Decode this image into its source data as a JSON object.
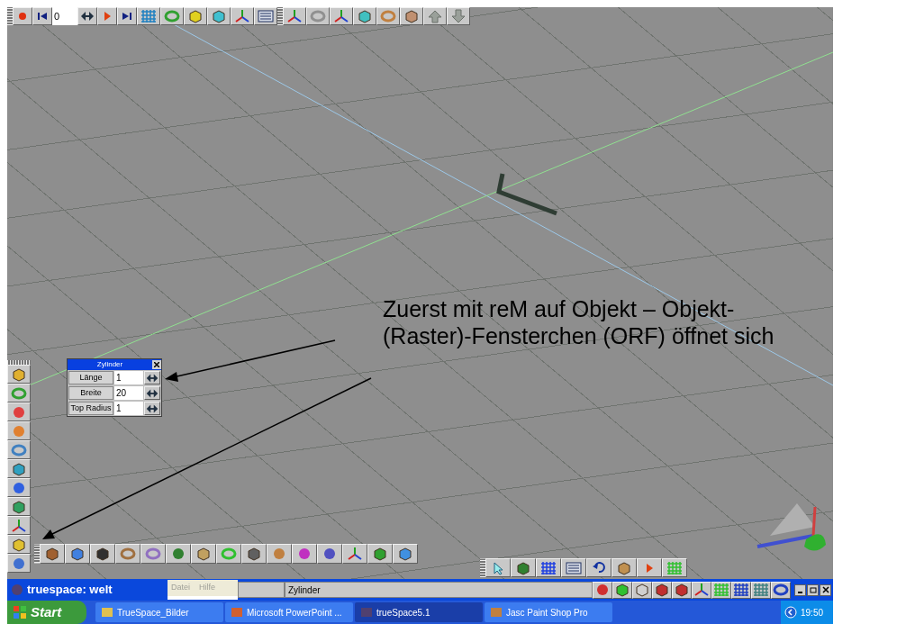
{
  "top_toolbar": {
    "frame_field": "0"
  },
  "parameter_panel": {
    "title": "Zylinder",
    "params": [
      {
        "label": "Länge",
        "value": "1"
      },
      {
        "label": "Breite",
        "value": "20"
      },
      {
        "label": "Top Radius",
        "value": "1"
      }
    ]
  },
  "annotation": "Zuerst mit reM auf Objekt – Objekt-\n(Raster)-Fensterchen (ORF) öffnet sich",
  "title_bar": {
    "title": "truespace: welt",
    "menu": [
      "Datei",
      "Hilfe"
    ],
    "status": "Zylinder"
  },
  "taskbar": {
    "start": "Start",
    "tasks": [
      {
        "label": "TrueSpace_Bilder",
        "selected": false
      },
      {
        "label": "Microsoft PowerPoint ...",
        "selected": false
      },
      {
        "label": "trueSpace5.1",
        "selected": true
      },
      {
        "label": "Jasc Paint Shop Pro",
        "selected": false
      }
    ],
    "clock": "19:50"
  }
}
